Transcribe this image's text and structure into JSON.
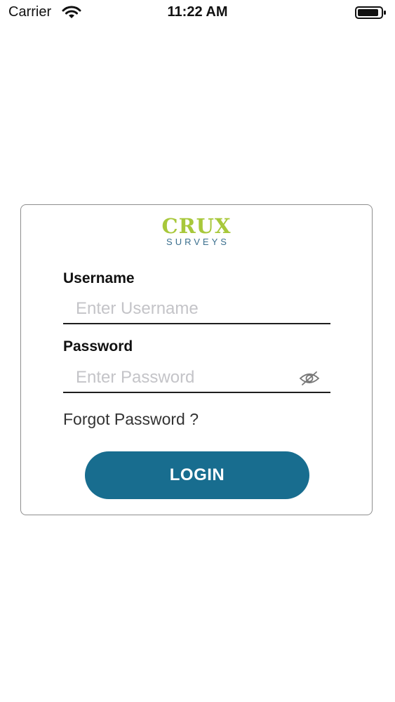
{
  "status_bar": {
    "carrier": "Carrier",
    "time": "11:22 AM",
    "wifi_icon": "wifi-icon",
    "battery_icon": "battery-icon"
  },
  "logo": {
    "main": "CRUX",
    "sub": "SURVEYS"
  },
  "form": {
    "username_label": "Username",
    "username_placeholder": "Enter Username",
    "username_value": "",
    "password_label": "Password",
    "password_placeholder": "Enter Password",
    "password_value": "",
    "password_toggle_icon": "eye-slash-icon",
    "forgot_password": "Forgot Password ?",
    "login_label": "LOGIN"
  },
  "colors": {
    "accent": "#186d8f",
    "logo_green": "#a8c83b",
    "logo_blue": "#3b6f8e",
    "card_border": "#8e8e8e"
  }
}
